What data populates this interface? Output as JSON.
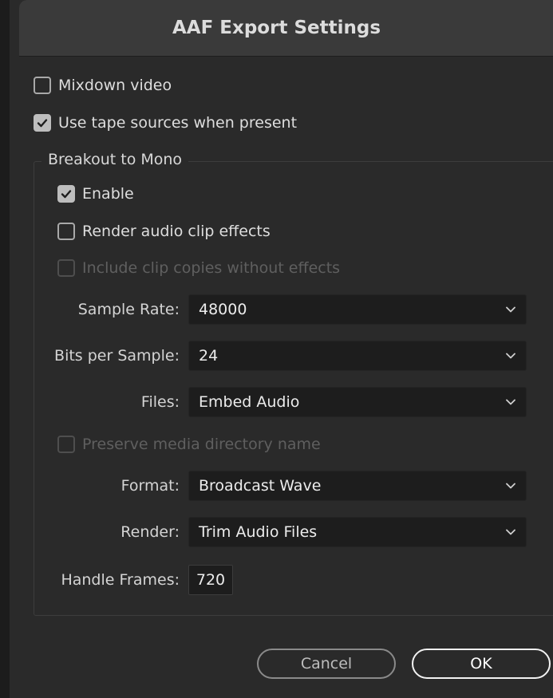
{
  "dialog": {
    "title": "AAF Export Settings"
  },
  "options": {
    "mixdown_video": {
      "label": "Mixdown video",
      "checked": false
    },
    "use_tape_sources": {
      "label": "Use tape sources when present",
      "checked": true
    }
  },
  "breakout": {
    "legend": "Breakout to Mono",
    "enable": {
      "label": "Enable",
      "checked": true
    },
    "render_audio_clip_effects": {
      "label": "Render audio clip effects",
      "checked": false
    },
    "include_clip_copies": {
      "label": "Include clip copies without effects",
      "checked": false,
      "disabled": true
    },
    "sample_rate": {
      "label": "Sample Rate:",
      "value": "48000"
    },
    "bits_per_sample": {
      "label": "Bits per Sample:",
      "value": "24"
    },
    "files": {
      "label": "Files:",
      "value": "Embed Audio"
    },
    "preserve_media_dir": {
      "label": "Preserve media directory name",
      "checked": false,
      "disabled": true
    },
    "format": {
      "label": "Format:",
      "value": "Broadcast Wave"
    },
    "render": {
      "label": "Render:",
      "value": "Trim Audio Files"
    },
    "handle_frames": {
      "label": "Handle Frames:",
      "value": "720"
    }
  },
  "buttons": {
    "cancel": "Cancel",
    "ok": "OK"
  }
}
